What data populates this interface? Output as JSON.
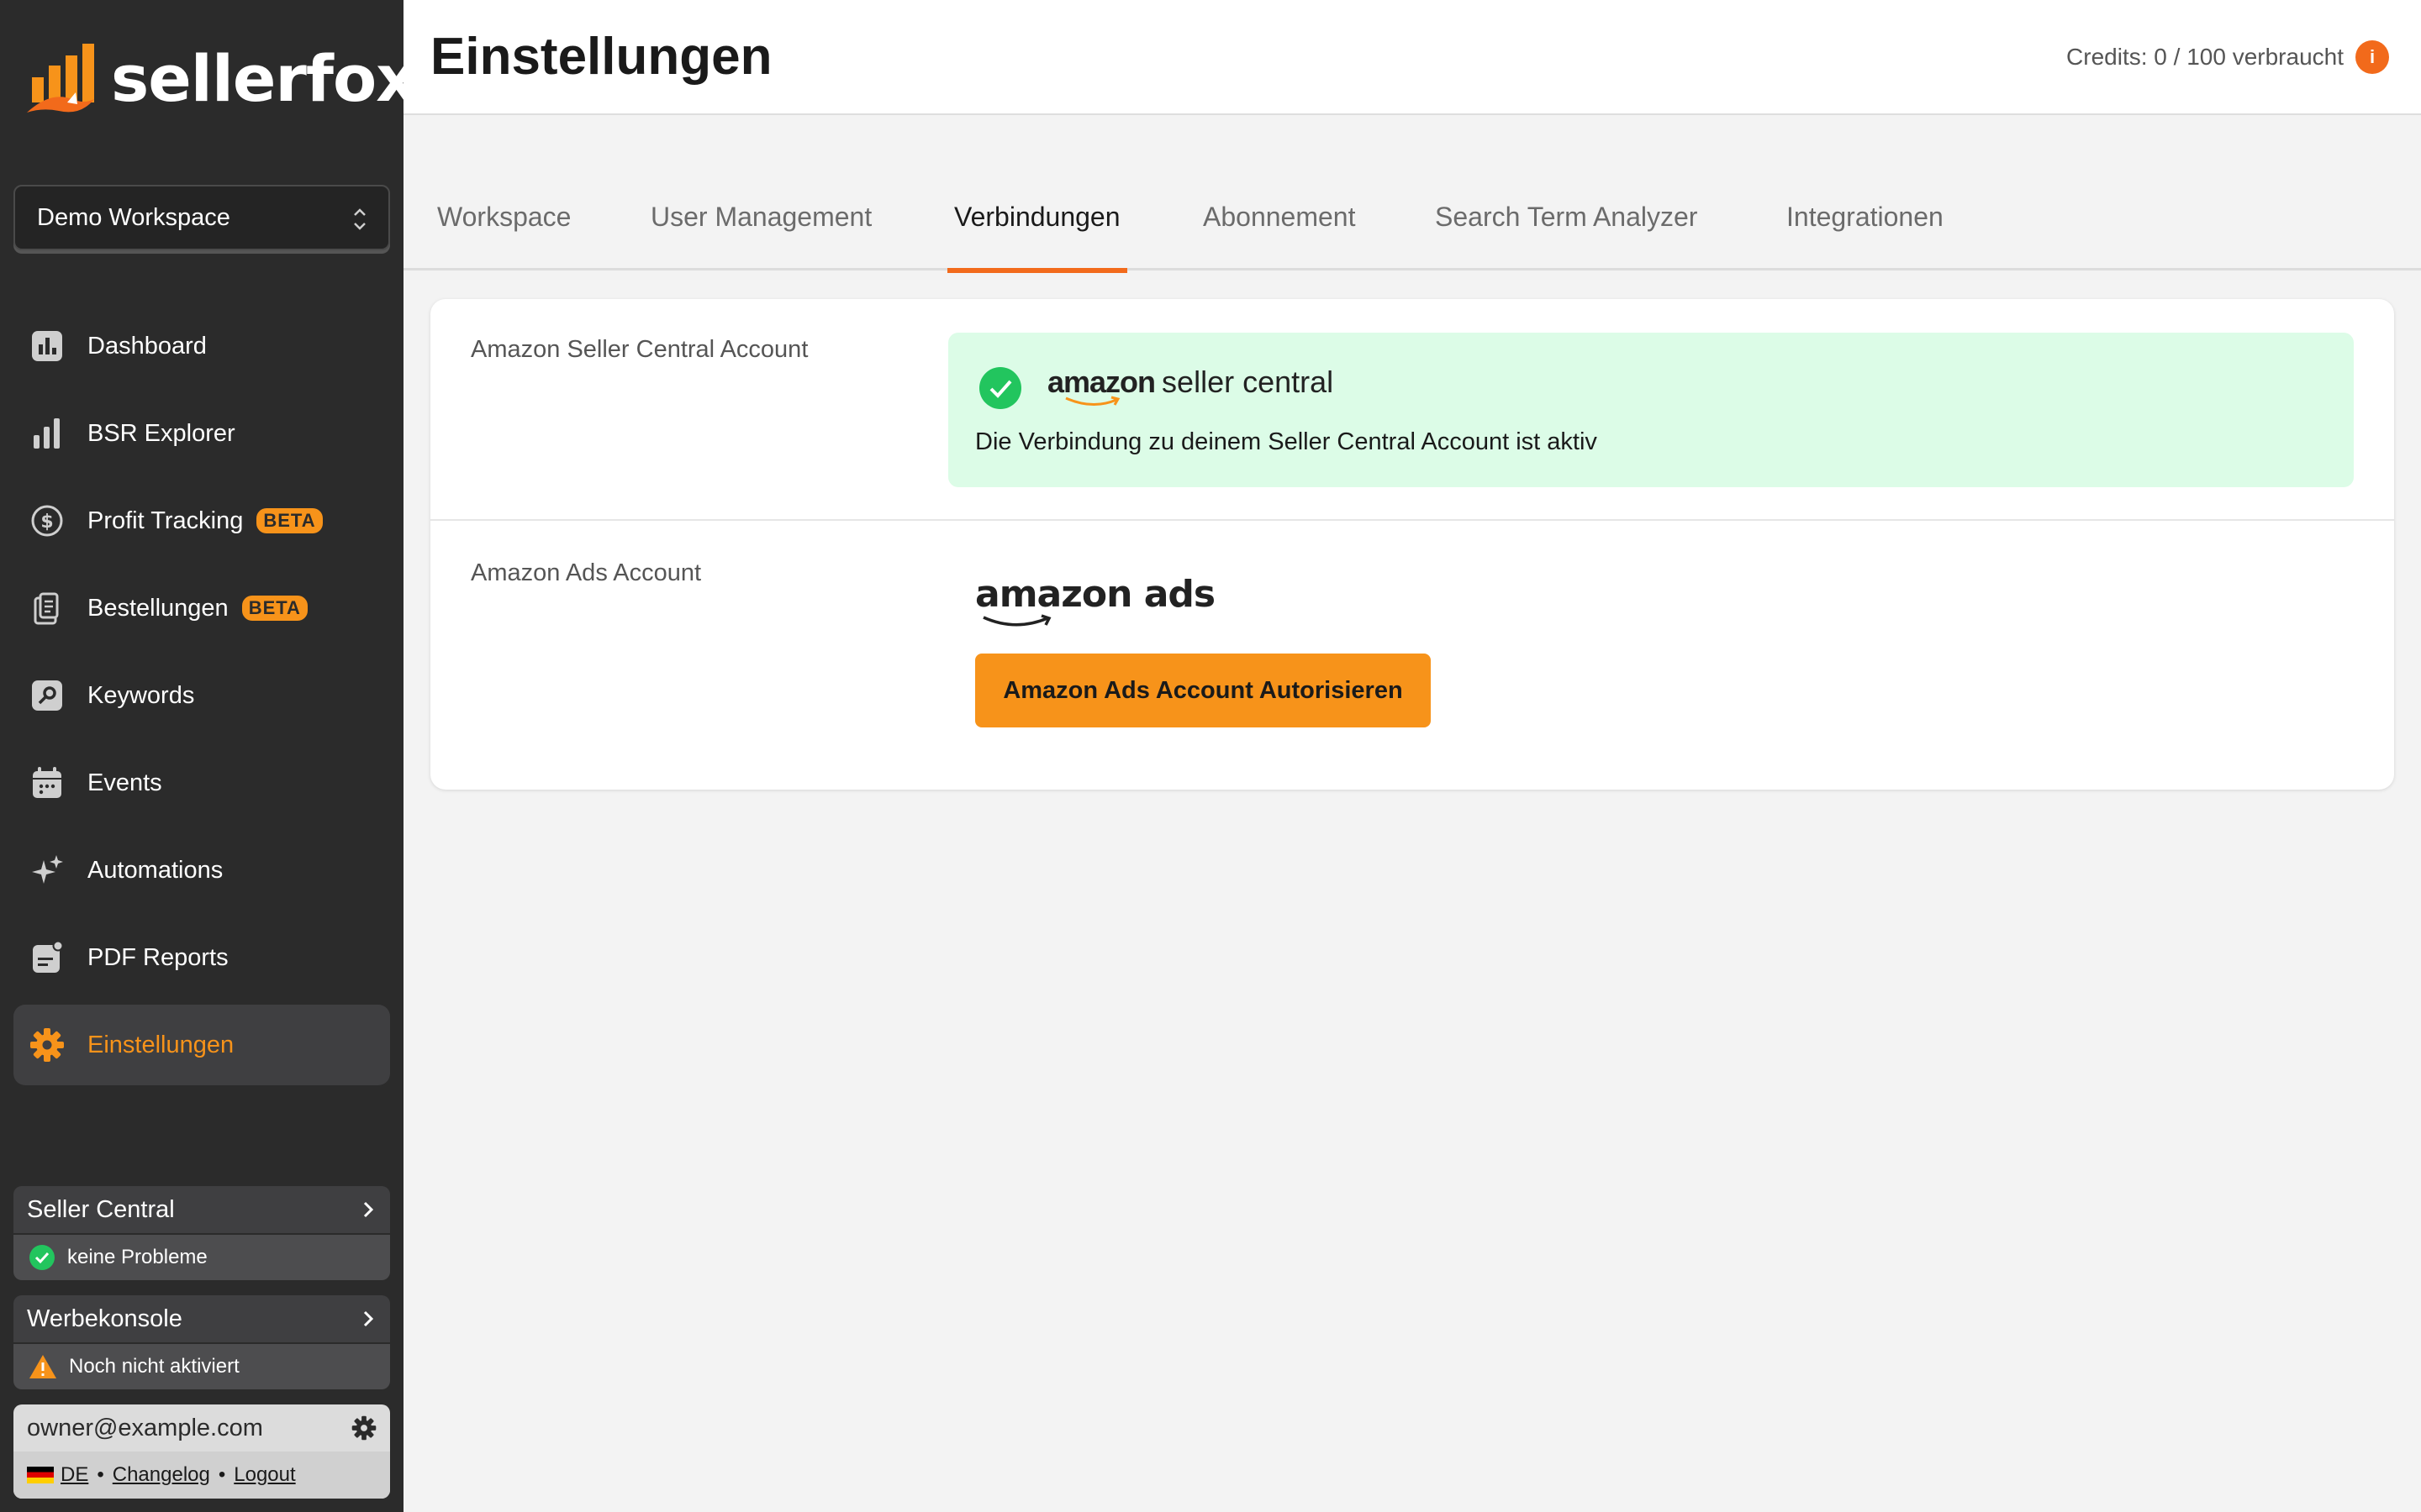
{
  "brand": {
    "name": "sellerfox",
    "accent": "#f7931a",
    "sidebar_bg": "#2b2b2b"
  },
  "workspace": {
    "label": "Demo Workspace",
    "icon": "updown-chevron-icon"
  },
  "nav": [
    {
      "label": "Dashboard",
      "icon": "dashboard-icon"
    },
    {
      "label": "BSR Explorer",
      "icon": "bar-chart-icon"
    },
    {
      "label": "Profit Tracking",
      "icon": "dollar-icon",
      "badge": "BETA"
    },
    {
      "label": "Bestellungen",
      "icon": "clipboard-icon",
      "badge": "BETA"
    },
    {
      "label": "Keywords",
      "icon": "key-icon"
    },
    {
      "label": "Events",
      "icon": "calendar-icon"
    },
    {
      "label": "Automations",
      "icon": "sparkles-icon"
    },
    {
      "label": "PDF Reports",
      "icon": "report-icon"
    },
    {
      "label": "Einstellungen",
      "icon": "gear-icon",
      "active": true
    }
  ],
  "status": {
    "seller_central": {
      "title": "Seller Central",
      "text": "keine Probleme",
      "state": "ok"
    },
    "ads_console": {
      "title": "Werbekonsole",
      "text": "Noch nicht aktiviert",
      "state": "warning"
    }
  },
  "user": {
    "email": "owner@example.com",
    "lang": "DE",
    "changelog": "Changelog",
    "logout": "Logout"
  },
  "header": {
    "title": "Einstellungen",
    "credits": "Credits: 0 / 100 verbraucht",
    "info": "i"
  },
  "tabs": [
    {
      "label": "Workspace"
    },
    {
      "label": "User Management"
    },
    {
      "label": "Verbindungen",
      "active": true
    },
    {
      "label": "Abonnement"
    },
    {
      "label": "Search Term Analyzer"
    },
    {
      "label": "Integrationen"
    }
  ],
  "connections": {
    "seller_central": {
      "label": "Amazon Seller Central Account",
      "logo_amazon": "amazon",
      "logo_suffix": "seller central",
      "message": "Die Verbindung zu deinem Seller Central Account ist aktiv",
      "status_color": "#dcfce7"
    },
    "ads": {
      "label": "Amazon Ads Account",
      "logo": "amazon ads",
      "button": "Amazon Ads Account Autorisieren"
    }
  }
}
